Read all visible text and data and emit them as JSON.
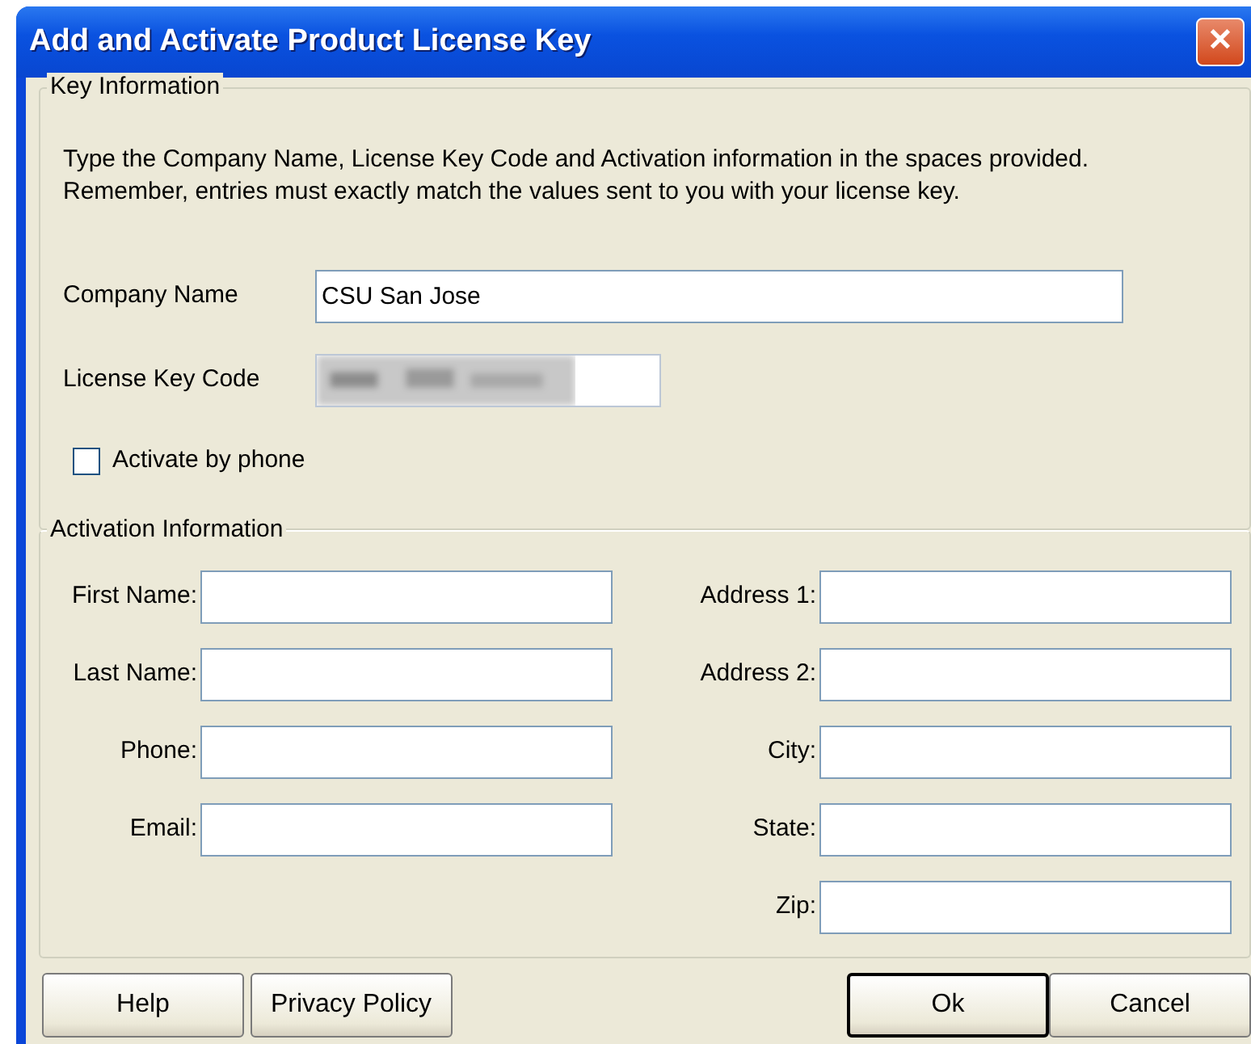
{
  "window": {
    "title": "Add and Activate Product License Key",
    "close": "✕"
  },
  "key_information": {
    "legend": "Key Information",
    "instructions": "Type the Company Name, License Key Code and Activation information in the spaces provided.\nRemember, entries must exactly match the values sent to you with your license key.",
    "company_name": {
      "label": "Company Name",
      "value": "CSU San Jose"
    },
    "license_key_code": {
      "label": "License Key Code",
      "obscured": true
    },
    "activate_by_phone": {
      "label": "Activate by phone",
      "checked": false
    }
  },
  "activation_information": {
    "legend": "Activation Information",
    "left_fields": [
      {
        "label": "First Name:"
      },
      {
        "label": "Last Name:"
      },
      {
        "label": "Phone:"
      },
      {
        "label": "Email:"
      }
    ],
    "right_fields": [
      {
        "label": "Address 1:"
      },
      {
        "label": "Address 2:"
      },
      {
        "label": "City:"
      },
      {
        "label": "State:"
      },
      {
        "label": "Zip:"
      }
    ]
  },
  "left_buttons": [
    {
      "label": "Help",
      "default": false
    },
    {
      "label": "Privacy Policy",
      "default": false
    }
  ],
  "right_buttons": [
    {
      "label": "Ok",
      "default": true
    },
    {
      "label": "Cancel",
      "default": false
    }
  ]
}
